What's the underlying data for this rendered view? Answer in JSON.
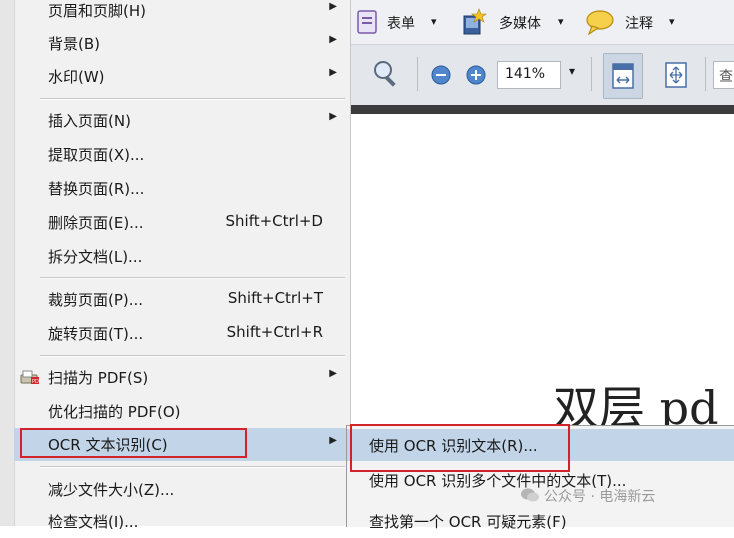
{
  "menu": {
    "items": [
      {
        "label": "页眉和页脚(H)",
        "shortcut": "",
        "submenu": true
      },
      {
        "label": "背景(B)",
        "shortcut": "",
        "submenu": true
      },
      {
        "label": "水印(W)",
        "shortcut": "",
        "submenu": true
      },
      {
        "label": "插入页面(N)",
        "shortcut": "",
        "submenu": true
      },
      {
        "label": "提取页面(X)...",
        "shortcut": "",
        "submenu": false
      },
      {
        "label": "替换页面(R)...",
        "shortcut": "",
        "submenu": false
      },
      {
        "label": "删除页面(E)...",
        "shortcut": "Shift+Ctrl+D",
        "submenu": false
      },
      {
        "label": "拆分文档(L)...",
        "shortcut": "",
        "submenu": false
      },
      {
        "label": "裁剪页面(P)...",
        "shortcut": "Shift+Ctrl+T",
        "submenu": false
      },
      {
        "label": "旋转页面(T)...",
        "shortcut": "Shift+Ctrl+R",
        "submenu": false
      },
      {
        "label": "扫描为 PDF(S)",
        "shortcut": "",
        "submenu": true
      },
      {
        "label": "优化扫描的 PDF(O)",
        "shortcut": "",
        "submenu": false
      },
      {
        "label": "OCR 文本识别(C)",
        "shortcut": "",
        "submenu": true
      },
      {
        "label": "减少文件大小(Z)...",
        "shortcut": "",
        "submenu": false
      },
      {
        "label": "检查文档(I)...",
        "shortcut": "",
        "submenu": false
      }
    ],
    "arrow": "▶"
  },
  "toolbar": {
    "form_label": "表单",
    "multimedia_label": "多媒体",
    "comment_label": "注释",
    "dropdown_glyph": "▾",
    "zoom_value": "141%",
    "partial_label": "查"
  },
  "document": {
    "visible_text": "双层 pd"
  },
  "submenu": {
    "items": [
      {
        "label": "使用 OCR 识别文本(R)..."
      },
      {
        "label": "使用 OCR 识别多个文件中的文本(T)..."
      },
      {
        "label": "查找第一个 OCR 可疑元素(F)"
      }
    ]
  },
  "watermark": {
    "text": "公众号 · 电海新云"
  },
  "colors": {
    "highlight": "#c2d4e8",
    "annotation_box": "#d2232a"
  }
}
